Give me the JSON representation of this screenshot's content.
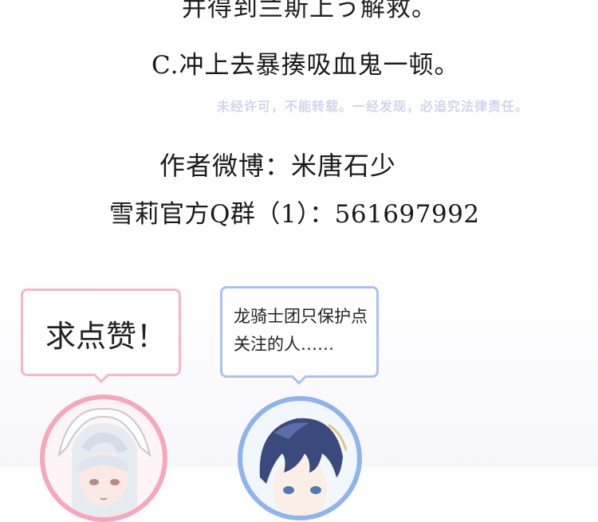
{
  "page": {
    "cut_line": "并得到兰斯上う解救。",
    "option_c": "C.冲上去暴揍吸血鬼一顿。",
    "watermark": "未经许可，不能转载。一经发现，必追究法律责任。",
    "author_line": "作者微博：米唐石少",
    "qq_group_line": "雪莉官方Q群（1）：561697992"
  },
  "bubbles": {
    "left_text": "求点赞！",
    "right_text": "龙骑士团只保护点关注的人……"
  },
  "colors": {
    "pink_accent": "#f4b7c6",
    "blue_accent": "#a9c3f0",
    "watermark": "#cfd6ec"
  }
}
